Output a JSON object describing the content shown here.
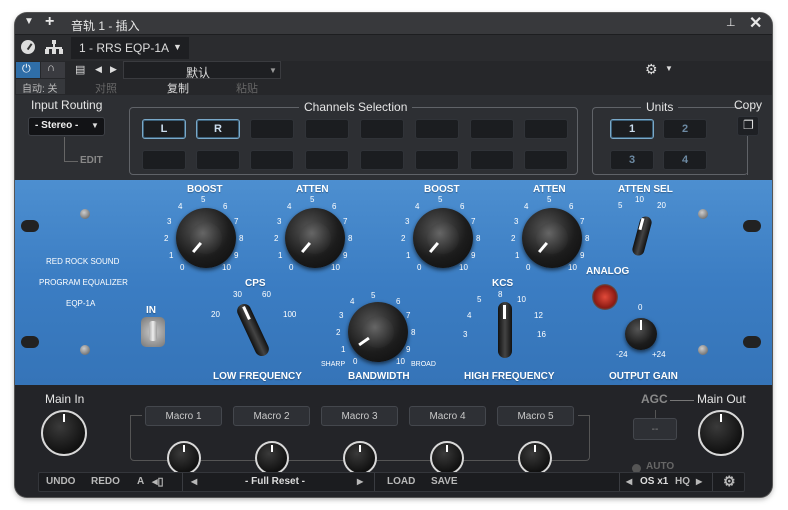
{
  "titlebar": {
    "title": "音轨 1 - 插入"
  },
  "toolbar": {
    "plugin_name": "1 - RRS EQP-1A",
    "preset": "默认",
    "auto_label": "自动: 关",
    "compare": "对照",
    "copy": "复制",
    "paste": "粘贴"
  },
  "routing": {
    "title": "Input Routing",
    "value": "- Stereo -",
    "edit": "EDIT"
  },
  "channels": {
    "title": "Channels Selection",
    "buttons": [
      "L",
      "R"
    ]
  },
  "units": {
    "title": "Units",
    "buttons": [
      "1",
      "2",
      "3",
      "4"
    ],
    "copy": "Copy"
  },
  "panel": {
    "brand_line1": "RED ROCK SOUND",
    "brand_line2": "PROGRAM EQUALIZER",
    "model": "EQP-1A",
    "in_label": "IN",
    "boost1": {
      "label": "BOOST",
      "scale": [
        "5",
        "4",
        "6",
        "3",
        "7",
        "2",
        "8",
        "1",
        "9",
        "0",
        "10"
      ]
    },
    "atten1": {
      "label": "ATTEN",
      "scale": [
        "5",
        "4",
        "6",
        "3",
        "7",
        "2",
        "8",
        "1",
        "9",
        "0",
        "10"
      ]
    },
    "boost2": {
      "label": "BOOST",
      "scale": [
        "5",
        "4",
        "6",
        "3",
        "7",
        "2",
        "8",
        "1",
        "9",
        "0",
        "10"
      ]
    },
    "atten2": {
      "label": "ATTEN",
      "scale": [
        "5",
        "4",
        "6",
        "3",
        "7",
        "2",
        "8",
        "1",
        "9",
        "0",
        "10"
      ]
    },
    "atten_sel": {
      "label": "ATTEN SEL",
      "scale": [
        "10",
        "5",
        "20"
      ]
    },
    "analog": "ANALOG",
    "cps": {
      "label": "CPS",
      "scale": [
        "30",
        "60",
        "20",
        "100"
      ]
    },
    "low_freq": "LOW FREQUENCY",
    "bandwidth": {
      "label": "BANDWIDTH",
      "scale": [
        "5",
        "4",
        "6",
        "3",
        "7",
        "2",
        "8",
        "1",
        "9",
        "0",
        "10"
      ],
      "sharp": "SHARP",
      "broad": "BROAD"
    },
    "kcs": {
      "label": "KCS",
      "scale": [
        "8",
        "5",
        "10",
        "4",
        "12",
        "3",
        "16"
      ]
    },
    "high_freq": "HIGH FREQUENCY",
    "output": {
      "label": "OUTPUT GAIN",
      "zero": "0",
      "min": "-24",
      "max": "+24"
    }
  },
  "bottom": {
    "main_in": "Main In",
    "macros": [
      "Macro 1",
      "Macro 2",
      "Macro 3",
      "Macro 4",
      "Macro 5"
    ],
    "agc": "AGC",
    "agc_value": "--",
    "auto": "AUTO",
    "main_out": "Main Out"
  },
  "status": {
    "undo": "UNDO",
    "redo": "REDO",
    "ab": "A",
    "preset": "- Full Reset -",
    "load": "LOAD",
    "save": "SAVE",
    "os": "OS x1",
    "hq": "HQ"
  }
}
